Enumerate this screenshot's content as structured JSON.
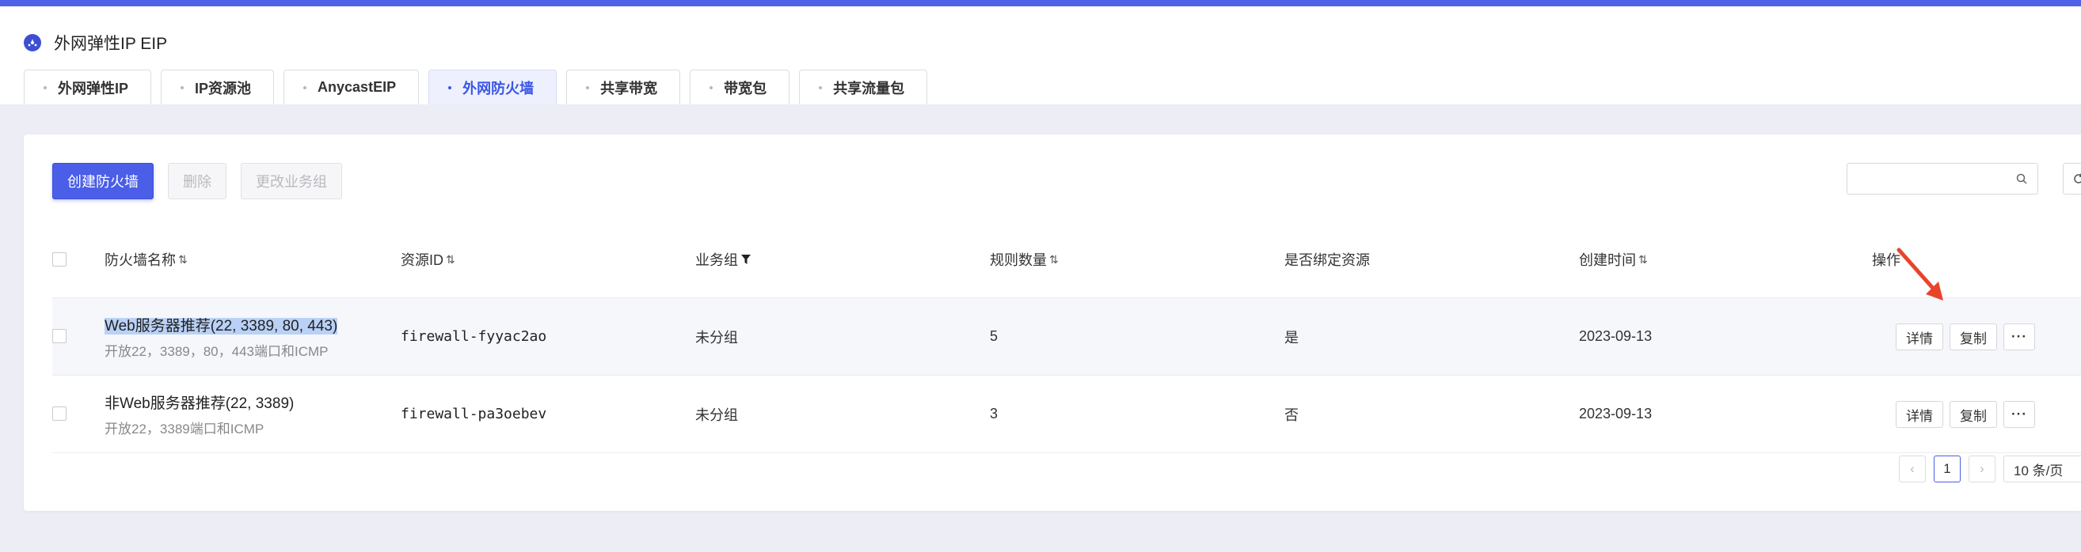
{
  "header": {
    "title": "外网弹性IP EIP"
  },
  "tabs": [
    {
      "label": "外网弹性IP",
      "active": false
    },
    {
      "label": "IP资源池",
      "active": false
    },
    {
      "label": "AnycastEIP",
      "active": false
    },
    {
      "label": "外网防火墙",
      "active": true
    },
    {
      "label": "共享带宽",
      "active": false
    },
    {
      "label": "带宽包",
      "active": false
    },
    {
      "label": "共享流量包",
      "active": false
    }
  ],
  "toolbar": {
    "create_label": "创建防火墙",
    "delete_label": "删除",
    "change_group_label": "更改业务组"
  },
  "search": {
    "placeholder": ""
  },
  "table": {
    "columns": {
      "name": "防火墙名称",
      "resource_id": "资源ID",
      "group": "业务组",
      "rule_count": "规则数量",
      "bound": "是否绑定资源",
      "created": "创建时间",
      "actions": "操作"
    },
    "rows": [
      {
        "name": "Web服务器推荐(22, 3389, 80, 443)",
        "desc": "开放22，3389，80，443端口和ICMP",
        "resource_id": "firewall-fyyac2ao",
        "group": "未分组",
        "rule_count": "5",
        "bound": "是",
        "created": "2023-09-13",
        "detail": "详情",
        "copy": "复制",
        "more": "···"
      },
      {
        "name": "非Web服务器推荐(22, 3389)",
        "desc": "开放22，3389端口和ICMP",
        "resource_id": "firewall-pa3oebev",
        "group": "未分组",
        "rule_count": "3",
        "bound": "否",
        "created": "2023-09-13",
        "detail": "详情",
        "copy": "复制",
        "more": "···"
      }
    ]
  },
  "pagination": {
    "prev": "‹",
    "current": "1",
    "next": "›",
    "page_size": "10 条/页"
  },
  "colors": {
    "accent": "#4a5ee8",
    "annotation_arrow": "#e8442c"
  }
}
